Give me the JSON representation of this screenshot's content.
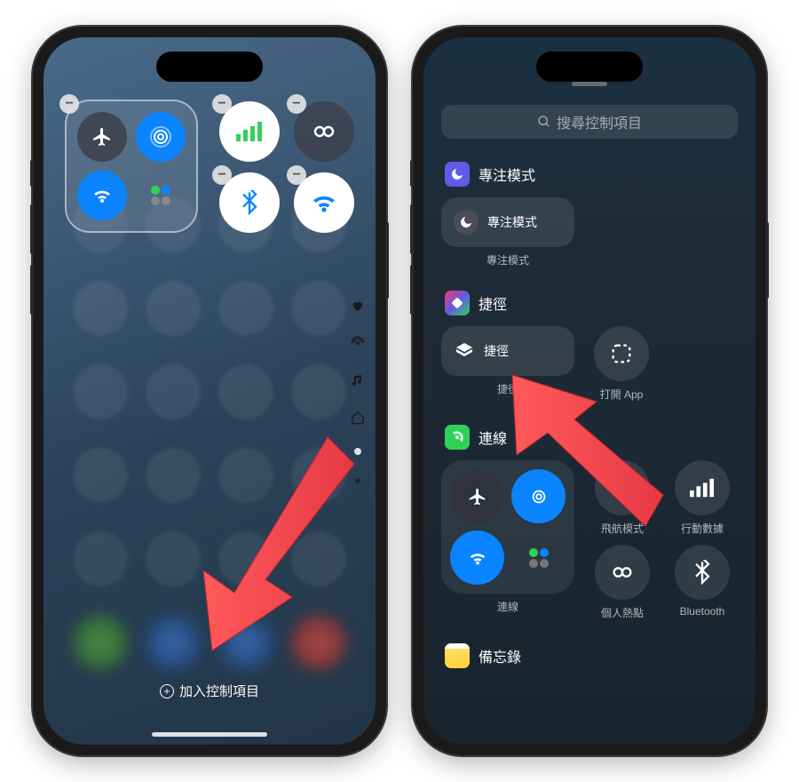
{
  "left": {
    "add_control": "加入控制項目",
    "icons": {
      "airplane": "airplane-icon",
      "airdrop": "airdrop-icon",
      "wifi": "wifi-icon",
      "cellular": "cellular-icon",
      "bluetooth": "bluetooth-icon",
      "hotspot": "hotspot-icon",
      "link": "link-icon"
    }
  },
  "right": {
    "search_placeholder": "搜尋控制項目",
    "focus": {
      "title": "專注模式",
      "item": "專注模式",
      "sub": "專注模式"
    },
    "shortcuts": {
      "title": "捷徑",
      "item1": "捷徑",
      "item1_sub": "捷徑",
      "item2": "打開 App"
    },
    "connectivity": {
      "title": "連線",
      "airplane": "飛航模式",
      "cellular": "行動數據",
      "conn": "連線",
      "hotspot": "個人熱點",
      "bluetooth": "Bluetooth"
    },
    "notes": {
      "title": "備忘錄"
    }
  }
}
